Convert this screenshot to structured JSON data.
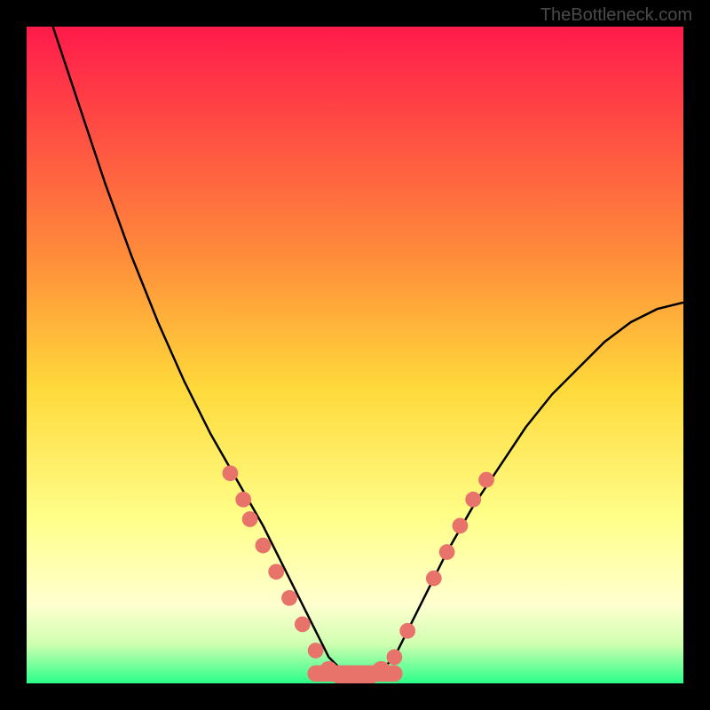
{
  "watermark": "TheBottleneck.com",
  "chart_data": {
    "type": "line",
    "title": "",
    "xlabel": "",
    "ylabel": "",
    "xlim": [
      0,
      100
    ],
    "ylim": [
      0,
      100
    ],
    "background_gradient": {
      "stops": [
        {
          "offset": 0,
          "color": "#ff1a4a"
        },
        {
          "offset": 35,
          "color": "#ff8c3a"
        },
        {
          "offset": 55,
          "color": "#ffd93a"
        },
        {
          "offset": 75,
          "color": "#ffff8a"
        },
        {
          "offset": 88,
          "color": "#ffffd0"
        },
        {
          "offset": 94,
          "color": "#d0ffb0"
        },
        {
          "offset": 100,
          "color": "#2aff8a"
        }
      ]
    },
    "series": [
      {
        "name": "bottleneck-curve",
        "color": "#000000",
        "x": [
          4,
          8,
          12,
          16,
          20,
          24,
          28,
          32,
          36,
          40,
          42,
          44,
          46,
          48,
          50,
          52,
          54,
          56,
          58,
          60,
          64,
          68,
          72,
          76,
          80,
          84,
          88,
          92,
          96,
          100
        ],
        "y": [
          100,
          88,
          76,
          65,
          55,
          46,
          38,
          31,
          24,
          16,
          12,
          8,
          4,
          2,
          1,
          1,
          2,
          4,
          8,
          12,
          20,
          27,
          33,
          39,
          44,
          48,
          52,
          55,
          57,
          58
        ]
      }
    ],
    "markers": [
      {
        "x": 31,
        "y": 32,
        "r": 1.2
      },
      {
        "x": 33,
        "y": 28,
        "r": 1.2
      },
      {
        "x": 34,
        "y": 25,
        "r": 1.2
      },
      {
        "x": 36,
        "y": 21,
        "r": 1.2
      },
      {
        "x": 38,
        "y": 17,
        "r": 1.2
      },
      {
        "x": 40,
        "y": 13,
        "r": 1.2
      },
      {
        "x": 42,
        "y": 9,
        "r": 1.2
      },
      {
        "x": 44,
        "y": 5,
        "r": 1.2
      },
      {
        "x": 46,
        "y": 2,
        "r": 1.4
      },
      {
        "x": 48,
        "y": 1,
        "r": 1.4
      },
      {
        "x": 50,
        "y": 1,
        "r": 1.4
      },
      {
        "x": 52,
        "y": 1,
        "r": 1.4
      },
      {
        "x": 54,
        "y": 2,
        "r": 1.4
      },
      {
        "x": 56,
        "y": 4,
        "r": 1.2
      },
      {
        "x": 58,
        "y": 8,
        "r": 1.2
      },
      {
        "x": 62,
        "y": 16,
        "r": 1.2
      },
      {
        "x": 64,
        "y": 20,
        "r": 1.2
      },
      {
        "x": 66,
        "y": 24,
        "r": 1.2
      },
      {
        "x": 68,
        "y": 28,
        "r": 1.2
      },
      {
        "x": 70,
        "y": 31,
        "r": 1.2
      }
    ],
    "marker_color": "#e8736b",
    "bottom_band": {
      "x_start": 44,
      "x_end": 56,
      "y": 1.5,
      "thickness": 2.5,
      "color": "#e8736b"
    }
  }
}
